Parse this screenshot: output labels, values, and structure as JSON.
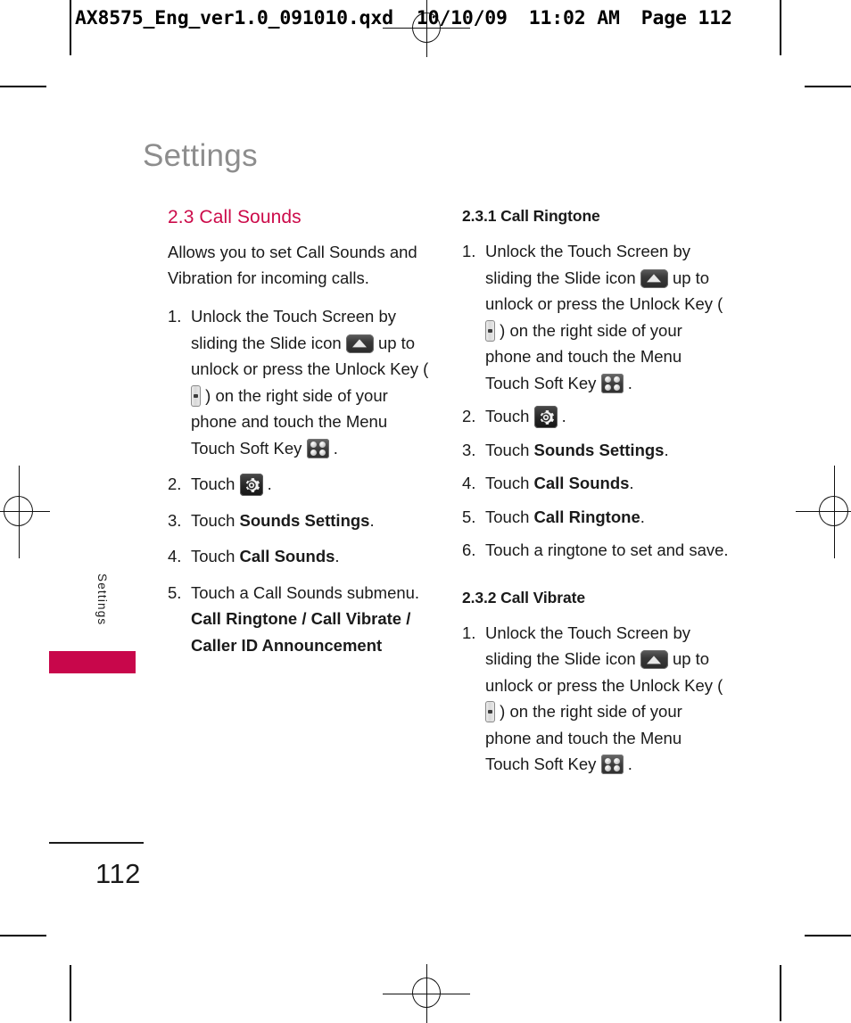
{
  "print_slug": {
    "filename": "AX8575_Eng_ver1.0_091010.qxd",
    "date": "10/10/09",
    "time": "11:02 AM",
    "page_label": "Page 112"
  },
  "page_title": "Settings",
  "side_tab_label": "Settings",
  "page_number": "112",
  "colors": {
    "accent": "#CC0B4A",
    "tab": "#C8074B",
    "title_gray": "#8D8D8D",
    "body": "#1A1A1A"
  },
  "left_column": {
    "heading": "2.3 Call Sounds",
    "intro": "Allows you to set Call Sounds and Vibration for incoming calls.",
    "steps": [
      {
        "num": "1.",
        "parts": [
          {
            "type": "text",
            "value": "Unlock the Touch Screen by sliding the Slide icon "
          },
          {
            "type": "icon",
            "value": "slide-icon"
          },
          {
            "type": "text",
            "value": " up to unlock or press the Unlock Key ( "
          },
          {
            "type": "icon",
            "value": "unlock-key-icon"
          },
          {
            "type": "text",
            "value": " ) on the right side of your phone and touch the Menu Touch Soft Key "
          },
          {
            "type": "icon",
            "value": "menu-touch-soft-key-icon"
          },
          {
            "type": "text",
            "value": " ."
          }
        ]
      },
      {
        "num": "2.",
        "parts": [
          {
            "type": "text",
            "value": "Touch "
          },
          {
            "type": "icon",
            "value": "gear-icon"
          },
          {
            "type": "text",
            "value": " ."
          }
        ]
      },
      {
        "num": "3.",
        "parts": [
          {
            "type": "text",
            "value": "Touch "
          },
          {
            "type": "bold",
            "value": "Sounds Settings"
          },
          {
            "type": "text",
            "value": "."
          }
        ]
      },
      {
        "num": "4.",
        "parts": [
          {
            "type": "text",
            "value": "Touch "
          },
          {
            "type": "bold",
            "value": "Call Sounds"
          },
          {
            "type": "text",
            "value": "."
          }
        ]
      },
      {
        "num": "5.",
        "parts": [
          {
            "type": "text",
            "value": "Touch a Call Sounds submenu. "
          },
          {
            "type": "bold",
            "value": "Call Ringtone / Call Vibrate / Caller ID Announcement"
          }
        ]
      }
    ]
  },
  "right_column": {
    "section_1": {
      "heading": "2.3.1 Call Ringtone",
      "steps": [
        {
          "num": "1.",
          "parts": [
            {
              "type": "text",
              "value": "Unlock the Touch Screen by sliding the Slide icon "
            },
            {
              "type": "icon",
              "value": "slide-icon"
            },
            {
              "type": "text",
              "value": " up to unlock or press the Unlock Key ( "
            },
            {
              "type": "icon",
              "value": "unlock-key-icon"
            },
            {
              "type": "text",
              "value": " ) on the right side of your phone and touch the Menu Touch Soft Key "
            },
            {
              "type": "icon",
              "value": "menu-touch-soft-key-icon"
            },
            {
              "type": "text",
              "value": " ."
            }
          ]
        },
        {
          "num": "2.",
          "parts": [
            {
              "type": "text",
              "value": "Touch "
            },
            {
              "type": "icon",
              "value": "gear-icon"
            },
            {
              "type": "text",
              "value": " ."
            }
          ]
        },
        {
          "num": "3.",
          "parts": [
            {
              "type": "text",
              "value": "Touch "
            },
            {
              "type": "bold",
              "value": "Sounds Settings"
            },
            {
              "type": "text",
              "value": "."
            }
          ]
        },
        {
          "num": "4.",
          "parts": [
            {
              "type": "text",
              "value": "Touch "
            },
            {
              "type": "bold",
              "value": "Call Sounds"
            },
            {
              "type": "text",
              "value": "."
            }
          ]
        },
        {
          "num": "5.",
          "parts": [
            {
              "type": "text",
              "value": "Touch "
            },
            {
              "type": "bold",
              "value": "Call Ringtone"
            },
            {
              "type": "text",
              "value": "."
            }
          ]
        },
        {
          "num": "6.",
          "parts": [
            {
              "type": "text",
              "value": "Touch a ringtone to set and save."
            }
          ]
        }
      ]
    },
    "section_2": {
      "heading": "2.3.2 Call Vibrate",
      "steps": [
        {
          "num": "1.",
          "parts": [
            {
              "type": "text",
              "value": "Unlock the Touch Screen by sliding the Slide icon "
            },
            {
              "type": "icon",
              "value": "slide-icon"
            },
            {
              "type": "text",
              "value": " up to unlock or press the Unlock Key ( "
            },
            {
              "type": "icon",
              "value": "unlock-key-icon"
            },
            {
              "type": "text",
              "value": " ) on the right side of your phone and touch the Menu Touch Soft Key "
            },
            {
              "type": "icon",
              "value": "menu-touch-soft-key-icon"
            },
            {
              "type": "text",
              "value": " ."
            }
          ]
        }
      ]
    }
  }
}
